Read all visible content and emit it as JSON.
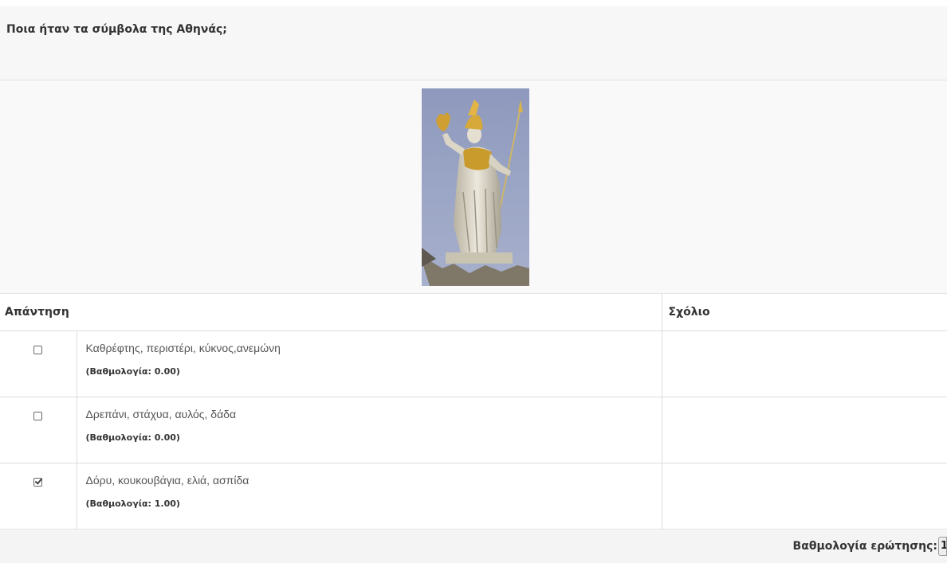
{
  "question": {
    "text": "Ποια ήταν τα σύμβολα της Αθηνάς;"
  },
  "table": {
    "header_answer": "Απάντηση",
    "header_comment": "Σχόλιο",
    "rows": [
      {
        "text": "Καθρέφτης, περιστέρι, κύκνος,ανεμώνη",
        "score": "(Βαθμολογία: 0.00)",
        "checked": false,
        "comment": ""
      },
      {
        "text": "Δρεπάνι, στάχυα, αυλός, δάδα",
        "score": "(Βαθμολογία: 0.00)",
        "checked": false,
        "comment": ""
      },
      {
        "text": "Δόρυ, κουκουβάγια, ελιά, ασπίδα",
        "score": "(Βαθμολογία: 1.00)",
        "checked": true,
        "comment": ""
      }
    ]
  },
  "footer": {
    "total_label": "Βαθμολογία ερώτησης:",
    "total_value": "1"
  }
}
